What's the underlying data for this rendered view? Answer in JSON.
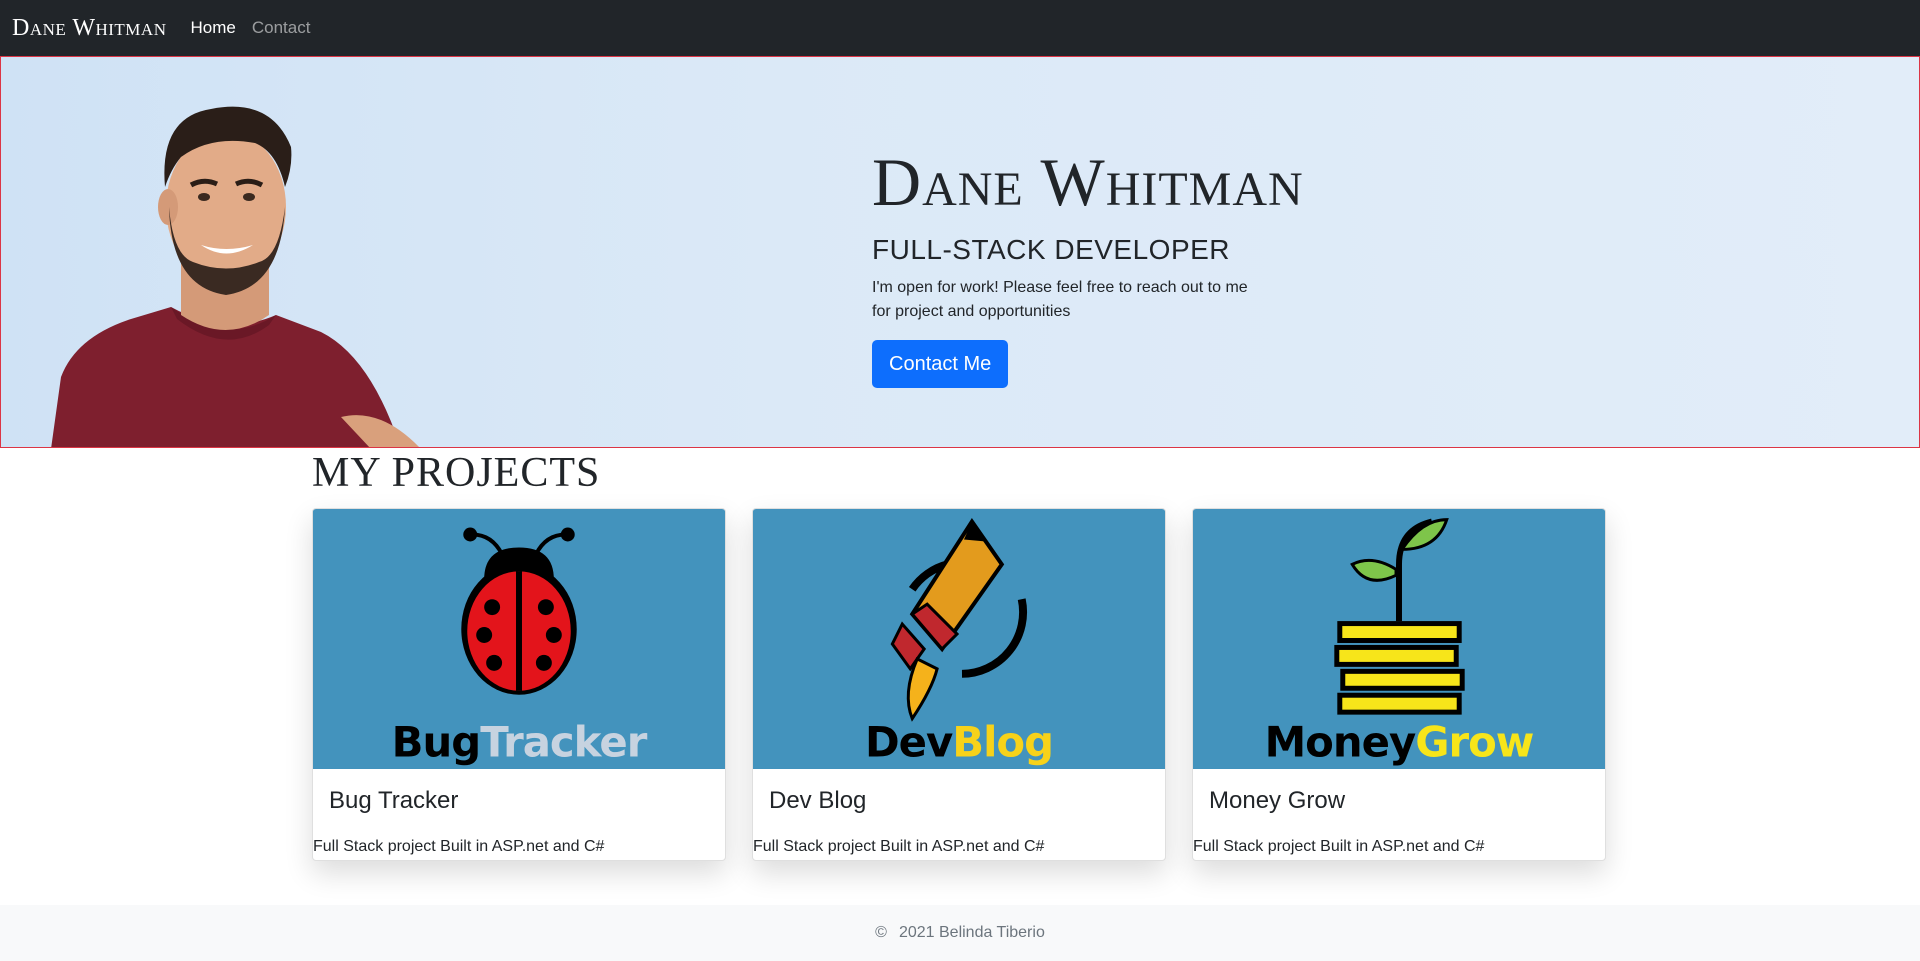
{
  "navbar": {
    "brand": "Dane Whitman",
    "links": [
      {
        "label": "Home",
        "active": true
      },
      {
        "label": "Contact",
        "active": false
      }
    ]
  },
  "hero": {
    "name": "Dane Whitman",
    "role": "FULL-STACK DEVELOPER",
    "description": "I'm open for work! Please feel free to reach out to me for project and opportunities",
    "cta_label": "Contact Me"
  },
  "projects": {
    "heading": "MY PROJECTS",
    "items": [
      {
        "logo_dark": "Bug",
        "logo_light": "Tracker",
        "title": "Bug Tracker",
        "text": "Full Stack project Built in ASP.net and C#",
        "icon": "ladybug-icon"
      },
      {
        "logo_dark": "Dev",
        "logo_light": "Blog",
        "title": "Dev Blog",
        "text": "Full Stack project Built in ASP.net and C#",
        "icon": "rocket-pencil-icon"
      },
      {
        "logo_dark": "Money",
        "logo_light": "Grow",
        "title": "Money Grow",
        "text": "Full Stack project Built in ASP.net and C#",
        "icon": "coin-plant-icon"
      }
    ]
  },
  "footer": {
    "copyright_symbol": "©",
    "text": "2021 Belinda Tiberio"
  },
  "colors": {
    "navbar_bg": "#212529",
    "primary": "#0d6efd",
    "card_image_bg": "#4393bd",
    "hero_border": "#dc3545"
  }
}
